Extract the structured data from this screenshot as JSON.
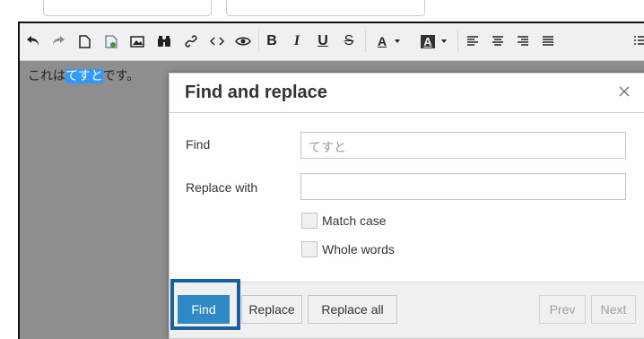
{
  "app": {
    "accent_color": "#2d8ac7",
    "selection_color": "#3399ff",
    "highlight_color": "#1b5fa3"
  },
  "toolbar": {
    "buttons": [
      {
        "name": "undo-icon"
      },
      {
        "name": "redo-icon"
      },
      {
        "name": "new-document-icon"
      },
      {
        "name": "image-icon"
      },
      {
        "name": "photo-icon"
      },
      {
        "name": "find-replace-icon"
      },
      {
        "name": "link-icon"
      },
      {
        "name": "code-icon"
      },
      {
        "name": "preview-icon"
      },
      {
        "name": "bold-icon",
        "text": "B"
      },
      {
        "name": "italic-icon",
        "text": "I"
      },
      {
        "name": "underline-icon",
        "text": "U"
      },
      {
        "name": "strikethrough-icon",
        "text": "S"
      },
      {
        "name": "text-color-icon",
        "text": "A"
      },
      {
        "name": "background-color-icon",
        "text": "A"
      },
      {
        "name": "align-left-icon"
      },
      {
        "name": "align-center-icon"
      },
      {
        "name": "align-right-icon"
      },
      {
        "name": "list-icon"
      }
    ]
  },
  "document": {
    "text_before": "これは",
    "text_selected": "てすと",
    "text_after": "です。"
  },
  "dialog": {
    "title": "Find and replace",
    "find_label": "Find",
    "find_value": "てすと",
    "replace_label": "Replace with",
    "replace_value": "",
    "match_case_label": "Match case",
    "match_case_checked": false,
    "whole_words_label": "Whole words",
    "whole_words_checked": false,
    "buttons": {
      "find": "Find",
      "replace": "Replace",
      "replace_all": "Replace all",
      "prev": "Prev",
      "next": "Next"
    }
  }
}
